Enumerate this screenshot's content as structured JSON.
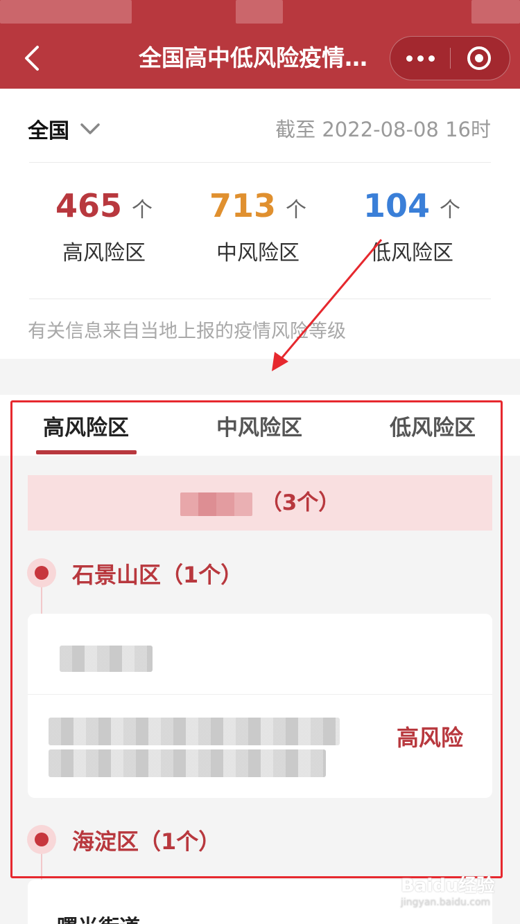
{
  "nav": {
    "title": "全国高中低风险疫情…"
  },
  "summary": {
    "region": "全国",
    "as_of": "截至 2022-08-08 16时",
    "stats": [
      {
        "value": "465",
        "unit": "个",
        "label": "高风险区",
        "color": "#b8383e"
      },
      {
        "value": "713",
        "unit": "个",
        "label": "中风险区",
        "color": "#e0902f"
      },
      {
        "value": "104",
        "unit": "个",
        "label": "低风险区",
        "color": "#3a7fd8"
      }
    ],
    "source_note": "有关信息来自当地上报的疫情风险等级"
  },
  "tabs": [
    "高风险区",
    "中风险区",
    "低风险区"
  ],
  "list": {
    "city_count": "（3个）",
    "districts": [
      {
        "name": "石景山区（1个）"
      },
      {
        "name": "海淀区（1个）"
      }
    ],
    "risk_level": "高风险",
    "street": "曙光街道"
  },
  "watermark": {
    "brand": "Baidu经验",
    "url": "jingyan.baidu.com"
  },
  "colors": {
    "accent": "#b8383e",
    "highlight": "#e6282e"
  }
}
